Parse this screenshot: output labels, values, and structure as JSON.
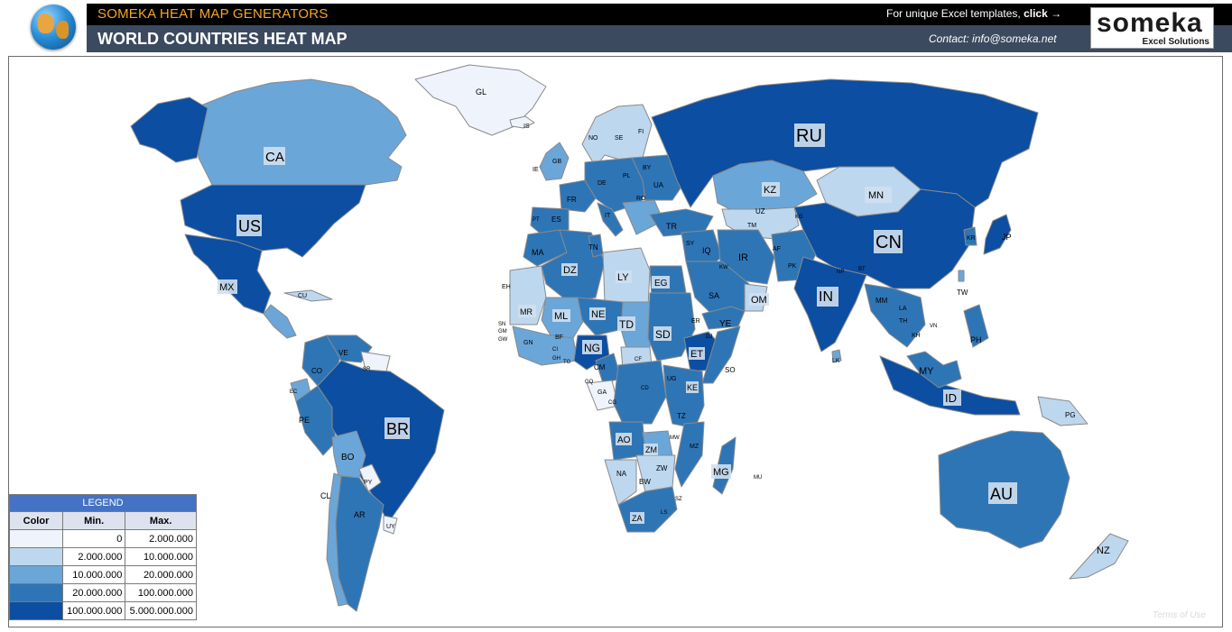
{
  "header": {
    "generator_title": "SOMEKA HEAT MAP GENERATORS",
    "page_title": "WORLD COUNTRIES HEAT MAP",
    "promo_text": "For unique Excel templates,",
    "promo_link": "click →",
    "contact": "Contact: info@someka.net",
    "logo_word": "someka",
    "logo_sub": "Excel Solutions"
  },
  "colors": {
    "tier0": "#eff3fc",
    "tier1": "#bdd7ee",
    "tier2": "#6ba6d8",
    "tier3": "#2e75b6",
    "tier4": "#0b4ea2",
    "border": "#8a8a8a"
  },
  "legend": {
    "title": "LEGEND",
    "col_color": "Color",
    "col_min": "Min.",
    "col_max": "Max.",
    "rows": [
      {
        "min": "0",
        "max": "2.000.000",
        "tier": 0
      },
      {
        "min": "2.000.000",
        "max": "10.000.000",
        "tier": 1
      },
      {
        "min": "10.000.000",
        "max": "20.000.000",
        "tier": 2
      },
      {
        "min": "20.000.000",
        "max": "100.000.000",
        "tier": 3
      },
      {
        "min": "100.000.000",
        "max": "5.000.000.000",
        "tier": 4
      }
    ]
  },
  "country_labels": {
    "GL": "GL",
    "IS": "IS",
    "CA": "CA",
    "US": "US",
    "MX": "MX",
    "CU": "CU",
    "RU": "RU",
    "KZ": "KZ",
    "MN": "MN",
    "CN": "CN",
    "IN": "IN",
    "JP": "JP",
    "KR": "KR",
    "TW": "TW",
    "PH": "PH",
    "MY": "MY",
    "ID": "ID",
    "PG": "PG",
    "AU": "AU",
    "NZ": "NZ",
    "IR": "IR",
    "IQ": "IQ",
    "SA": "SA",
    "OM": "OM",
    "YE": "YE",
    "TR": "TR",
    "AF": "AF",
    "PK": "PK",
    "NP": "NP",
    "BT": "BT",
    "MM": "MM",
    "LA": "LA",
    "TH": "TH",
    "KH": "KH",
    "VN": "VN",
    "LK": "LK",
    "TM": "TM",
    "UZ": "UZ",
    "KG": "KG",
    "SY": "SY",
    "KW": "KW",
    "NO": "NO",
    "SE": "SE",
    "FI": "FI",
    "GB": "GB",
    "IE": "IE",
    "FR": "FR",
    "ES": "ES",
    "PT": "PT",
    "DE": "DE",
    "PL": "PL",
    "IT": "IT",
    "UA": "UA",
    "BY": "BY",
    "RO": "RO",
    "MA": "MA",
    "DZ": "DZ",
    "TN": "TN",
    "LY": "LY",
    "EG": "EG",
    "EH": "EH",
    "MR": "MR",
    "ML": "ML",
    "NE": "NE",
    "TD": "TD",
    "SD": "SD",
    "ER": "ER",
    "DJ": "DJ",
    "ET": "ET",
    "SO": "SO",
    "NG": "NG",
    "SN": "SN",
    "GM": "GM",
    "GW": "GW",
    "GN": "GN",
    "BF": "BF",
    "CI": "CI",
    "GH": "GH",
    "TG": "TG",
    "CM": "CM",
    "CF": "CF",
    "GQ": "GQ",
    "GA": "GA",
    "CG": "CG",
    "CD": "CD",
    "UG": "UG",
    "KE": "KE",
    "TZ": "TZ",
    "AO": "AO",
    "ZM": "ZM",
    "MW": "MW",
    "MZ": "MZ",
    "ZW": "ZW",
    "NA": "NA",
    "BW": "BW",
    "ZA": "ZA",
    "LS": "LS",
    "SZ": "SZ",
    "MG": "MG",
    "MU": "MU",
    "CO": "CO",
    "VE": "VE",
    "EC": "EC",
    "PE": "PE",
    "BR": "BR",
    "BO": "BO",
    "PY": "PY",
    "CL": "CL",
    "AR": "AR",
    "UY": "UY",
    "SR": "SR"
  },
  "footer": {
    "terms": "Terms of Use"
  }
}
